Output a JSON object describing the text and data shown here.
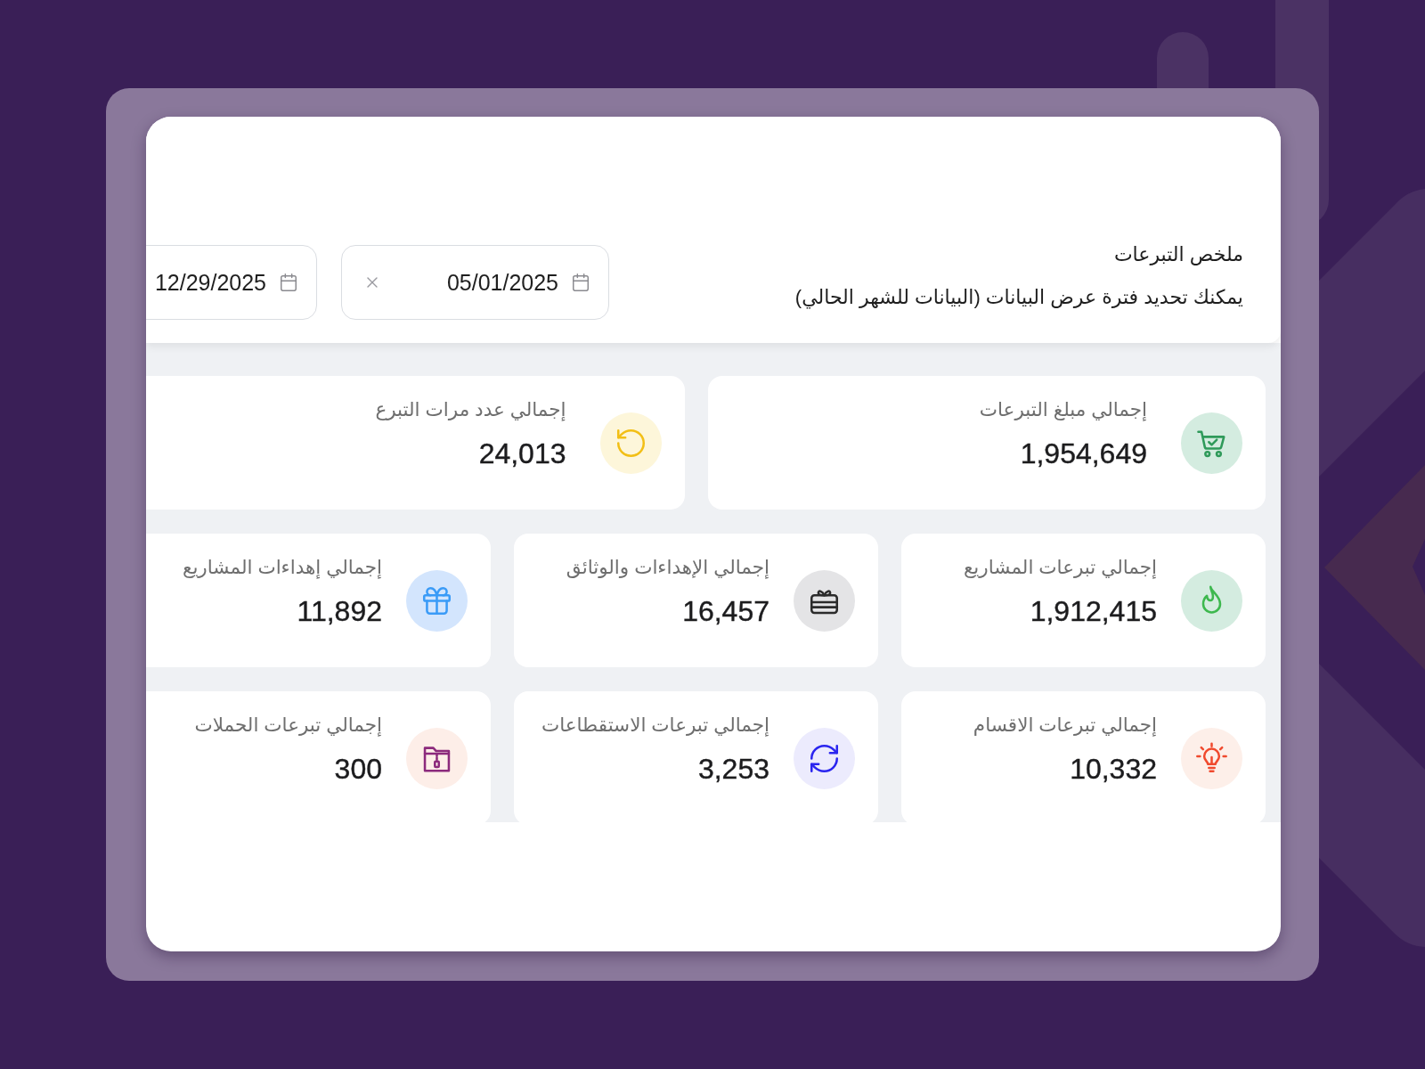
{
  "header": {
    "title": "ملخص التبرعات",
    "subtitle": "يمكنك تحديد فترة عرض البيانات (البيانات للشهر الحالي)"
  },
  "date_range": {
    "start": "05/01/2025",
    "end": "12/29/2025"
  },
  "stat_rows": [
    {
      "cards": [
        {
          "kind": "cart",
          "label": "إجمالي مبلغ التبرعات",
          "value": "1,954,649"
        },
        {
          "kind": "rotate",
          "label": "إجمالي عدد مرات التبرع",
          "value": "24,013"
        }
      ]
    },
    {
      "cards": [
        {
          "kind": "flame",
          "label": "إجمالي تبرعات المشاريع",
          "value": "1,912,415"
        },
        {
          "kind": "gift-card",
          "label": "إجمالي الإهداءات والوثائق",
          "value": "16,457"
        },
        {
          "kind": "gift",
          "label": "إجمالي إهداءات المشاريع",
          "value": "11,892"
        }
      ]
    },
    {
      "cards": [
        {
          "kind": "bulb",
          "label": "إجمالي تبرعات الاقسام",
          "value": "10,332"
        },
        {
          "kind": "refresh",
          "label": "إجمالي تبرعات الاستقطاعات",
          "value": "3,253"
        },
        {
          "kind": "folder",
          "label": "إجمالي تبرعات الحملات",
          "value": "300"
        }
      ]
    }
  ]
}
